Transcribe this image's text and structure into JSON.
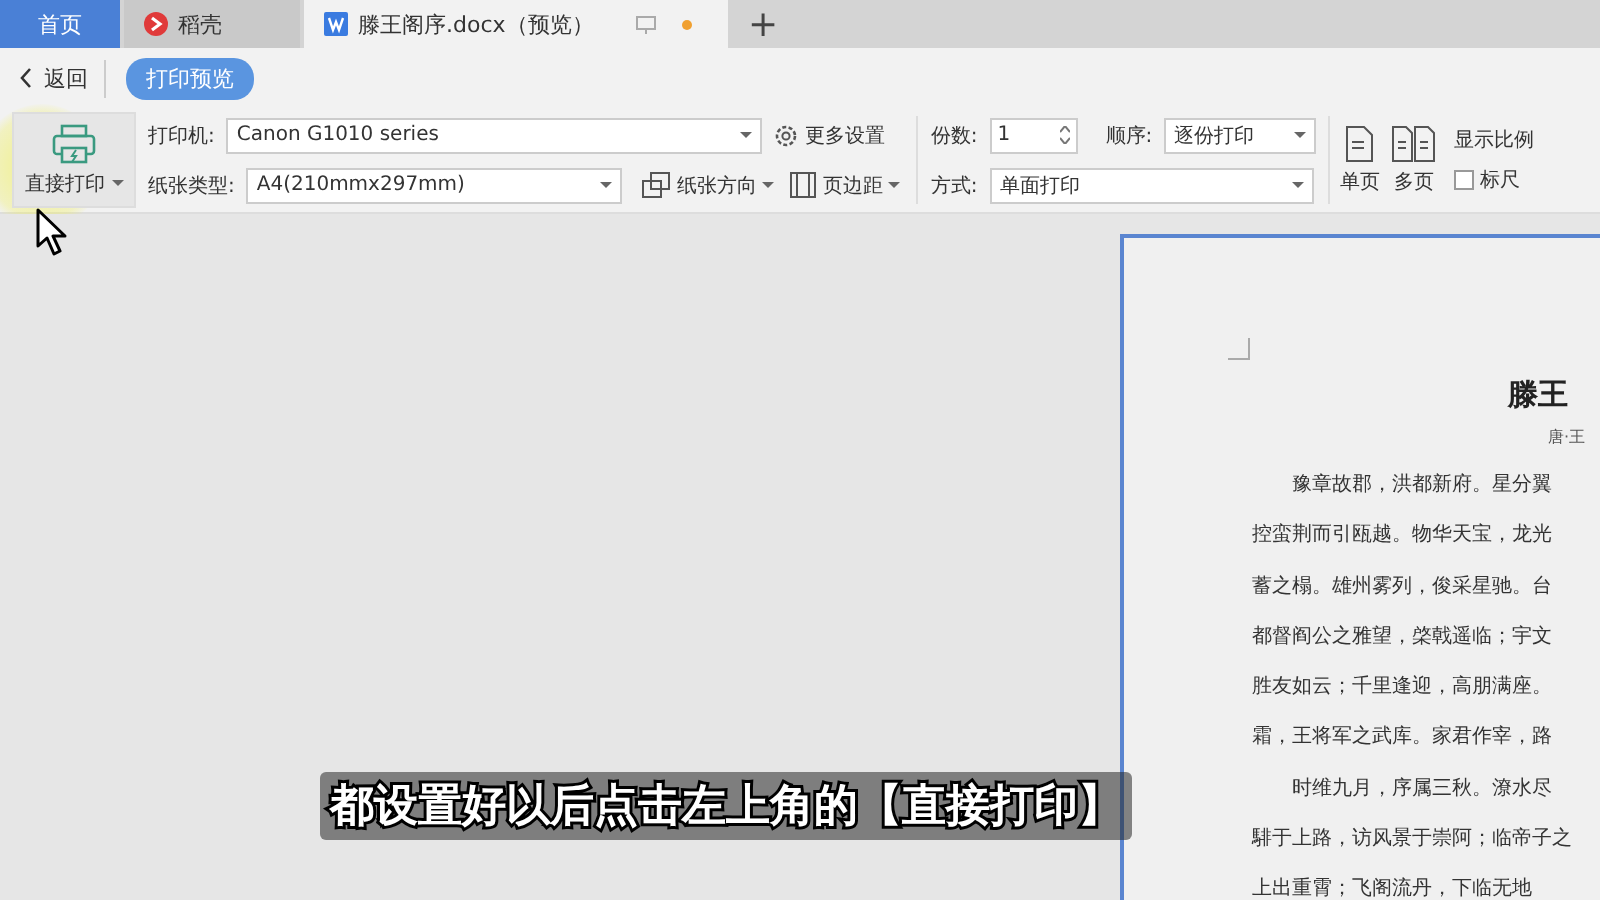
{
  "tabs": [
    {
      "label": "首页",
      "kind": "home",
      "selected": false
    },
    {
      "label": "稻壳",
      "kind": "app",
      "selected": false
    },
    {
      "label": "滕王阁序.docx（预览）",
      "kind": "doc",
      "selected": true
    }
  ],
  "new_tab": "+",
  "nav": {
    "back": "返回",
    "mode": "打印预览"
  },
  "ribbon": {
    "direct_print": "直接打印",
    "printer_label": "打印机:",
    "printer": "Canon G1010 series",
    "more_settings": "更多设置",
    "copies_label": "份数:",
    "copies": "1",
    "order_label": "顺序:",
    "order": "逐份打印",
    "paper_label": "纸张类型:",
    "paper": "A4(210mmx297mm)",
    "orientation": "纸张方向",
    "margins": "页边距",
    "mode_label": "方式:",
    "mode": "单面打印",
    "single_page": "单页",
    "multi_page": "多页",
    "zoom": "显示比例",
    "ruler": {
      "label": "标尺",
      "checked": false
    }
  },
  "document": {
    "title": "滕王",
    "author": "唐·王",
    "lines": [
      {
        "text": "豫章故郡，洪都新府。星分翼",
        "indent": true
      },
      {
        "text": "控蛮荆而引瓯越。物华天宝，龙光",
        "indent": false
      },
      {
        "text": "蓄之榻。雄州雾列，俊采星驰。台",
        "indent": false
      },
      {
        "text": "都督阎公之雅望，棨戟遥临；宇文",
        "indent": false
      },
      {
        "text": "胜友如云；千里逢迎，高朋满座。",
        "indent": false
      },
      {
        "text": "霜，王将军之武库。家君作宰，路",
        "indent": false
      },
      {
        "text": "时维九月，序属三秋。潦水尽",
        "indent": true
      },
      {
        "text": "騑于上路，访风景于崇阿；临帝子之",
        "indent": false
      },
      {
        "text": "上出重霄；飞阁流丹，下临无地",
        "indent": false
      }
    ]
  },
  "subtitle": "都设置好以后点击左上角的【直接打印】"
}
